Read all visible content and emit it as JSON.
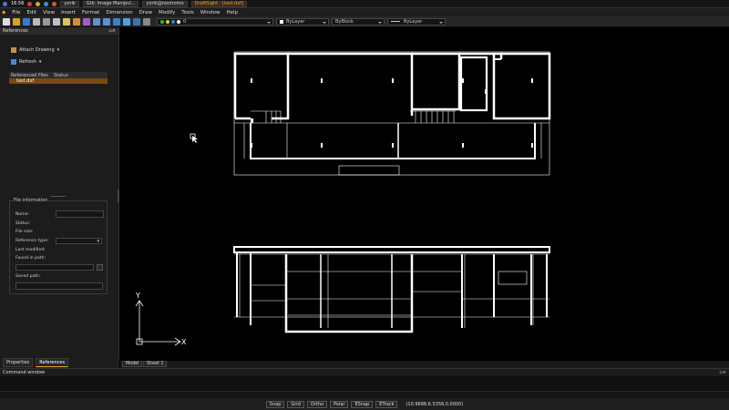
{
  "taskbar": {
    "clock": "16:56",
    "windows": [
      {
        "label": "yorik",
        "active": false
      },
      {
        "label": "Gtk: Image Manipul...",
        "active": false
      },
      {
        "label": "yorik@nostromo",
        "active": false
      },
      {
        "label": "DraftSight - [test.dxf]",
        "active": true
      }
    ]
  },
  "menu": [
    "File",
    "Edit",
    "View",
    "Insert",
    "Format",
    "Dimension",
    "Draw",
    "Modify",
    "Tools",
    "Window",
    "Help"
  ],
  "toolbar": {
    "layer_value": "0",
    "color_value": "ByLayer",
    "linestyle_value": "ByBlock",
    "lineweight_value": "ByLayer"
  },
  "references_panel": {
    "title": "References",
    "attach_label": "Attach Drawing",
    "refresh_label": "Refresh",
    "columns": [
      "Referenced Files",
      "Status"
    ],
    "files": [
      "test.dxf"
    ]
  },
  "file_info": {
    "title": "File information",
    "name_label": "Name:",
    "status_label": "Status:",
    "filesize_label": "File size:",
    "reftype_label": "Reference type:",
    "lastmod_label": "Last modified:",
    "foundpath_label": "Found in path:",
    "savedpath_label": "Saved path:"
  },
  "panel_tabs": [
    "Properties",
    "References"
  ],
  "sheet_tabs": [
    "Model",
    "Sheet 1"
  ],
  "command_window": {
    "title": "Command window"
  },
  "axes": {
    "y": "Y",
    "x": "X"
  },
  "status_buttons": [
    "Snap",
    "Grid",
    "Ortho",
    "Polar",
    "ESnap",
    "ETrack"
  ],
  "coordinates": "(10.9688,6.5358,0.0000)",
  "colors": {
    "accent": "#f0a030",
    "selection": "#7a4a10",
    "drawing": "#ffffff"
  }
}
